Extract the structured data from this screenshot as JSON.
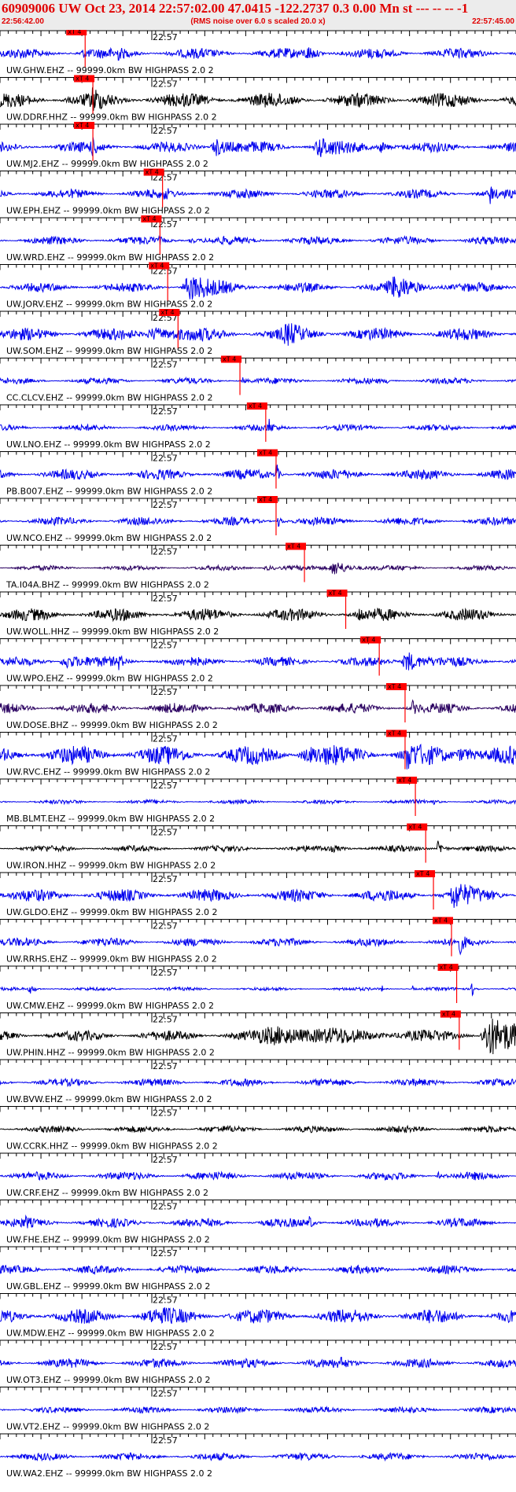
{
  "header": {
    "title": "60909006 UW Oct 23, 2014 22:57:02.00   47.0415 -122.2737  0.3 0.00 Mn st --- -- --   -1",
    "start_time": "22:56:42.00",
    "noise_note": "(RMS noise over 6.0 s scaled 20.0 x)",
    "end_time": "22:57:45.00"
  },
  "chart_data": {
    "type": "line",
    "minute_label": "22:57",
    "pick_label": "xT 4",
    "traces": [
      {
        "label": "UW.GHW.EHZ -- 99999.0km BW  HIGHPASS  2.0  2",
        "color": "#0000ee",
        "pick": 0.165,
        "noise": 0.25,
        "bursts": [
          [
            0.16,
            0.12,
            0.02,
            0.9
          ],
          [
            0.6,
            0.25,
            0.04,
            0.6
          ],
          [
            0.23,
            0.15,
            0.02,
            0.5
          ]
        ]
      },
      {
        "label": "UW.DDRF.HHZ -- 99999.0km BW  HIGHPASS  2.0  2",
        "color": "#000000",
        "pick": 0.18,
        "noise": 0.35,
        "bursts": [
          [
            0.18,
            0.4,
            0.015,
            0.9
          ]
        ]
      },
      {
        "label": "UW.MJ2.EHZ -- 99999.0km BW  HIGHPASS  2.0  2",
        "color": "#0000ee",
        "pick": 0.18,
        "noise": 0.25,
        "bursts": [
          [
            0.18,
            0.25,
            0.02,
            0.9
          ],
          [
            0.42,
            0.4,
            0.04,
            0.9
          ],
          [
            0.62,
            0.4,
            0.04,
            0.9
          ],
          [
            0.74,
            0.25,
            0.03,
            0.7
          ]
        ]
      },
      {
        "label": "UW.EPH.EHZ -- 99999.0km BW  HIGHPASS  2.0  2",
        "color": "#0000ee",
        "pick": 0.315,
        "noise": 0.22,
        "bursts": [
          [
            0.32,
            0.2,
            0.01,
            0.9
          ],
          [
            0.95,
            0.5,
            0.004,
            1
          ]
        ]
      },
      {
        "label": "UW.WRD.EHZ -- 99999.0km BW  HIGHPASS  2.0  2",
        "color": "#0000ee",
        "pick": 0.31,
        "noise": 0.2,
        "bursts": [
          [
            0.37,
            0.15,
            0.015,
            0.7
          ],
          [
            0.31,
            0.1,
            0.01,
            0.5
          ]
        ]
      },
      {
        "label": "UW.JORV.EHZ -- 99999.0km BW  HIGHPASS  2.0  2",
        "color": "#0000ee",
        "pick": 0.325,
        "noise": 0.22,
        "bursts": [
          [
            0.37,
            0.55,
            0.06,
            0.9
          ],
          [
            0.77,
            0.4,
            0.07,
            0.8
          ]
        ]
      },
      {
        "label": "UW.SOM.EHZ -- 99999.0km BW  HIGHPASS  2.0  2",
        "color": "#0000ee",
        "pick": 0.345,
        "noise": 0.3,
        "bursts": [
          [
            0.3,
            0.3,
            0.06,
            0.9
          ],
          [
            0.56,
            0.3,
            0.05,
            0.7
          ]
        ]
      },
      {
        "label": "CC.CLCV.EHZ -- 99999.0km BW  HIGHPASS  2.0  2",
        "color": "#0000ee",
        "pick": 0.465,
        "noise": 0.15,
        "bursts": [
          [
            0.47,
            0.15,
            0.008,
            0.8
          ],
          [
            0.75,
            0.1,
            0.004,
            1
          ]
        ]
      },
      {
        "label": "UW.LNO.EHZ -- 99999.0km BW  HIGHPASS  2.0  2",
        "color": "#0000ee",
        "pick": 0.515,
        "noise": 0.15,
        "bursts": [
          [
            0.52,
            0.4,
            0.008,
            0.9
          ]
        ]
      },
      {
        "label": "PB.B007.EHZ -- 99999.0km BW  HIGHPASS  2.0  2",
        "color": "#0000ee",
        "pick": 0.535,
        "noise": 0.25,
        "bursts": [
          [
            0.535,
            0.85,
            0.004,
            1
          ]
        ]
      },
      {
        "label": "UW.NCO.EHZ -- 99999.0km BW  HIGHPASS  2.0  2",
        "color": "#0000ee",
        "pick": 0.535,
        "noise": 0.2,
        "bursts": [
          [
            0.54,
            0.3,
            0.008,
            0.9
          ]
        ]
      },
      {
        "label": "TA.I04A.BHZ -- 99999.0km BW  HIGHPASS  2.0  2",
        "color": "#2a0060",
        "pick": 0.59,
        "noise": 0.12,
        "bursts": [
          [
            0.65,
            0.35,
            0.04,
            0.9
          ],
          [
            0.52,
            0.1,
            0.04,
            0.6
          ]
        ]
      },
      {
        "label": "UW.WOLL.HHZ -- 99999.0km BW  HIGHPASS  2.0  2",
        "color": "#000000",
        "pick": 0.67,
        "noise": 0.3,
        "bursts": [
          [
            0.695,
            0.3,
            0.01,
            0.9
          ]
        ]
      },
      {
        "label": "UW.WPO.EHZ -- 99999.0km BW  HIGHPASS  2.0  2",
        "color": "#0000ee",
        "pick": 0.735,
        "noise": 0.22,
        "bursts": [
          [
            0.79,
            0.5,
            0.04,
            0.9
          ],
          [
            0.13,
            0.3,
            0.05,
            0.8
          ],
          [
            0.23,
            0.3,
            0.01,
            0.8
          ]
        ]
      },
      {
        "label": "UW.DOSE.BHZ -- 99999.0km BW  HIGHPASS  2.0  2",
        "color": "#2a0060",
        "pick": 0.785,
        "noise": 0.25,
        "bursts": [
          [
            0.8,
            0.3,
            0.01,
            0.9
          ]
        ]
      },
      {
        "label": "UW.RVC.EHZ -- 99999.0km BW  HIGHPASS  2.0  2",
        "color": "#0000ee",
        "pick": 0.785,
        "noise": 0.45,
        "bursts": [
          [
            0.79,
            0.5,
            0.02,
            0.9
          ],
          [
            0.6,
            0.25,
            0.08,
            0.5
          ],
          [
            0.9,
            0.3,
            0.06,
            0.7
          ]
        ]
      },
      {
        "label": "MB.BLMT.EHZ -- 99999.0km BW  HIGHPASS  2.0  2",
        "color": "#0000ee",
        "pick": 0.805,
        "noise": 0.1,
        "bursts": [
          [
            0.84,
            0.08,
            0.02,
            0.5
          ]
        ]
      },
      {
        "label": "UW.IRON.HHZ -- 99999.0km BW  HIGHPASS  2.0  2",
        "color": "#000000",
        "pick": 0.825,
        "noise": 0.15,
        "bursts": [
          [
            0.85,
            0.45,
            0.012,
            0.9
          ],
          [
            0.65,
            0.1,
            0.05,
            0.5
          ]
        ]
      },
      {
        "label": "UW.GLDO.EHZ -- 99999.0km BW  HIGHPASS  2.0  2",
        "color": "#0000ee",
        "pick": 0.84,
        "noise": 0.3,
        "bursts": [
          [
            0.88,
            0.5,
            0.04,
            0.9
          ]
        ]
      },
      {
        "label": "UW.RRHS.EHZ -- 99999.0km BW  HIGHPASS  2.0  2",
        "color": "#0000ee",
        "pick": 0.875,
        "noise": 0.2,
        "bursts": [
          [
            0.89,
            0.5,
            0.01,
            0.9
          ]
        ]
      },
      {
        "label": "UW.CMW.EHZ -- 99999.0km BW  HIGHPASS  2.0  2",
        "color": "#0000ee",
        "pick": 0.885,
        "noise": 0.08,
        "bursts": [
          [
            0.915,
            0.35,
            0.008,
            0.9
          ],
          [
            0.06,
            0.2,
            0.02,
            0.6
          ],
          [
            0.74,
            0.2,
            0.004,
            0.7
          ],
          [
            0.8,
            0.2,
            0.004,
            0.7
          ]
        ]
      },
      {
        "label": "UW.PHIN.HHZ -- 99999.0km BW  HIGHPASS  2.0  2",
        "color": "#000000",
        "pick": 0.89,
        "noise": 0.25,
        "bursts": [
          [
            0.55,
            0.35,
            0.2,
            0.9
          ],
          [
            0.95,
            0.85,
            0.06,
            1
          ]
        ]
      },
      {
        "label": "UW.BVW.EHZ -- 99999.0km BW  HIGHPASS  2.0  2",
        "color": "#0000ee",
        "pick": null,
        "noise": 0.18,
        "bursts": []
      },
      {
        "label": "UW.CCRK.HHZ -- 99999.0km BW  HIGHPASS  2.0  2",
        "color": "#000000",
        "pick": null,
        "noise": 0.16,
        "bursts": []
      },
      {
        "label": "UW.CRF.EHZ -- 99999.0km BW  HIGHPASS  2.0  2",
        "color": "#0000ee",
        "pick": null,
        "noise": 0.2,
        "bursts": [
          [
            0.85,
            0.15,
            0.01,
            0.8
          ]
        ]
      },
      {
        "label": "UW.FHE.EHZ -- 99999.0km BW  HIGHPASS  2.0  2",
        "color": "#0000ee",
        "pick": null,
        "noise": 0.22,
        "bursts": [
          [
            0.6,
            0.4,
            0.004,
            1
          ],
          [
            0.05,
            0.15,
            0.01,
            0.8
          ]
        ]
      },
      {
        "label": "UW.GBL.EHZ -- 99999.0km BW  HIGHPASS  2.0  2",
        "color": "#0000ee",
        "pick": null,
        "noise": 0.2,
        "bursts": []
      },
      {
        "label": "UW.MDW.EHZ -- 99999.0km BW  HIGHPASS  2.0  2",
        "color": "#0000ee",
        "pick": null,
        "noise": 0.35,
        "bursts": [
          [
            0.3,
            0.15,
            0.1,
            0.5
          ]
        ]
      },
      {
        "label": "UW.OT3.EHZ -- 99999.0km BW  HIGHPASS  2.0  2",
        "color": "#0000ee",
        "pick": null,
        "noise": 0.22,
        "bursts": [
          [
            0.6,
            0.15,
            0.02,
            0.7
          ],
          [
            0.66,
            0.12,
            0.02,
            0.7
          ]
        ]
      },
      {
        "label": "UW.VT2.EHZ -- 99999.0km BW  HIGHPASS  2.0  2",
        "color": "#0000ee",
        "pick": null,
        "noise": 0.15,
        "bursts": []
      },
      {
        "label": "UW.WA2.EHZ -- 99999.0km BW  HIGHPASS  2.0  2",
        "color": "#0000ee",
        "pick": null,
        "noise": 0.18,
        "bursts": []
      }
    ]
  }
}
